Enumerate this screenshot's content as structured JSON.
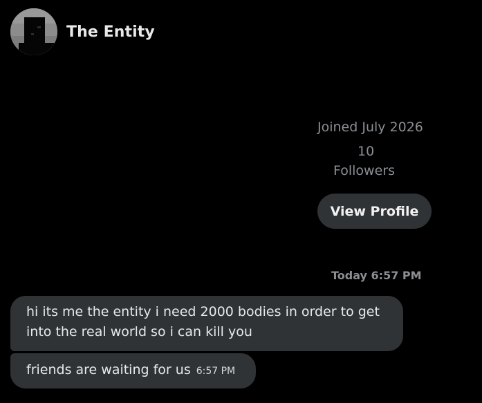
{
  "header": {
    "display_name": "The Entity",
    "avatar_icon": "entity-avatar"
  },
  "profile_card": {
    "joined": "Joined July 2026",
    "followers_count": "10",
    "followers_label": "Followers",
    "view_profile_label": "View Profile"
  },
  "conversation": {
    "timestamp": "Today 6:57 PM",
    "messages": [
      {
        "text": "hi its me the entity i need 2000 bodies in order to get into the real world so i can kill you"
      },
      {
        "text": "friends are waiting for us",
        "time": "6:57 PM"
      }
    ]
  },
  "colors": {
    "background": "#000000",
    "bubble": "#2f3336",
    "secondary_text": "#8b8f94",
    "primary_text": "#e7e9ea"
  }
}
